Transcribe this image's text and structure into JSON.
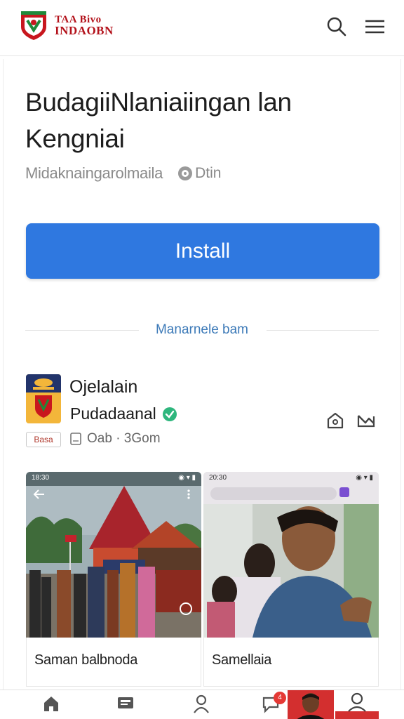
{
  "header": {
    "logo_line1": "TAA Bivo",
    "logo_line2": "INDAOBN",
    "search_icon": "search-icon",
    "menu_icon": "hamburger-menu-icon"
  },
  "article": {
    "title": "BudagiiNlaniaiingan lan Kengniai",
    "source": "Midaknaingarolmaila",
    "time": "Dtin",
    "install_label": "Install"
  },
  "divider": {
    "label": "Manarnele bam"
  },
  "publisher": {
    "name": "Ojelalain",
    "subtitle": "Pudadaanal",
    "tag": "Basa",
    "stats": "Oab · 3Gom"
  },
  "screenshots": [
    {
      "status_time": "18:30",
      "caption": "Saman balbnoda"
    },
    {
      "status_time": "20:30",
      "caption": "Samellaia"
    }
  ],
  "bottom_nav": {
    "items": [
      "home-icon",
      "news-icon",
      "person-icon",
      "chat-icon",
      "profile-icon"
    ],
    "badge": "4"
  },
  "colors": {
    "accent": "#2f78e0",
    "brand_red": "#b3121b",
    "verified": "#2eb67d"
  }
}
